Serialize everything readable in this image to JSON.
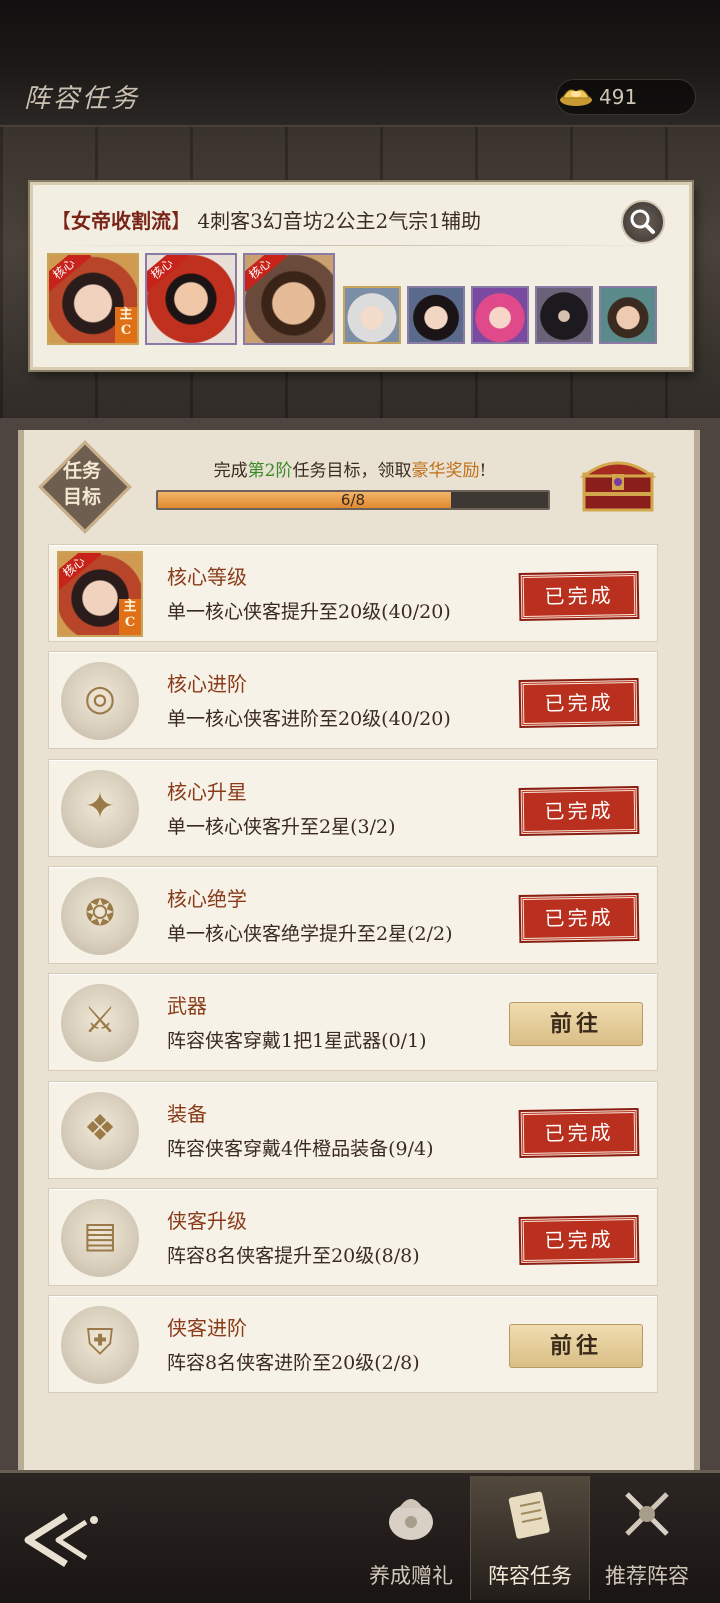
{
  "header": {
    "title": "阵容任务",
    "currency_value": "491"
  },
  "lineup": {
    "name": "女帝收割流",
    "composition": "4刺客3幻音坊2公主2气宗1辅助",
    "core_tag": "核心",
    "main_tag": "主C"
  },
  "goal": {
    "badge_line1": "任务",
    "badge_line2": "目标",
    "text_prefix": "完成",
    "stage": "第2阶",
    "text_middle": "任务目标，领取",
    "reward": "豪华奖励",
    "text_suffix": "!",
    "progress_text": "6/8",
    "progress_fraction": 0.75
  },
  "tasks": [
    {
      "title": "核心等级",
      "desc": "单一核心侠客提升至20级(40/20)",
      "status": "已完成",
      "icon": "core-hero-portrait"
    },
    {
      "title": "核心进阶",
      "desc": "单一核心侠客进阶至20级(40/20)",
      "status": "已完成",
      "icon": "advance-emblem-icon"
    },
    {
      "title": "核心升星",
      "desc": "单一核心侠客升至2星(3/2)",
      "status": "已完成",
      "icon": "wings-star-icon"
    },
    {
      "title": "核心绝学",
      "desc": "单一核心侠客绝学提升至2星(2/2)",
      "status": "已完成",
      "icon": "skill-scroll-icon"
    },
    {
      "title": "武器",
      "desc": "阵容侠客穿戴1把1星武器(0/1)",
      "status": "前往",
      "icon": "weapon-icon"
    },
    {
      "title": "装备",
      "desc": "阵容侠客穿戴4件橙品装备(9/4)",
      "status": "已完成",
      "icon": "equipment-icon"
    },
    {
      "title": "侠客升级",
      "desc": "阵容8名侠客提升至20级(8/8)",
      "status": "已完成",
      "icon": "book-icon"
    },
    {
      "title": "侠客进阶",
      "desc": "阵容8名侠客进阶至20级(2/8)",
      "status": "前往",
      "icon": "helmet-icon"
    }
  ],
  "nav": {
    "tabs": [
      {
        "label": "养成赠礼",
        "icon": "gift-bag-icon"
      },
      {
        "label": "阵容任务",
        "icon": "task-scroll-icon",
        "active": true
      },
      {
        "label": "推荐阵容",
        "icon": "swords-icon"
      }
    ]
  },
  "colors": {
    "accent_red": "#b9301e",
    "progress_orange": "#e08a30",
    "title_brown": "#8a3c1a",
    "panel_bg": "#e9e1d1"
  }
}
